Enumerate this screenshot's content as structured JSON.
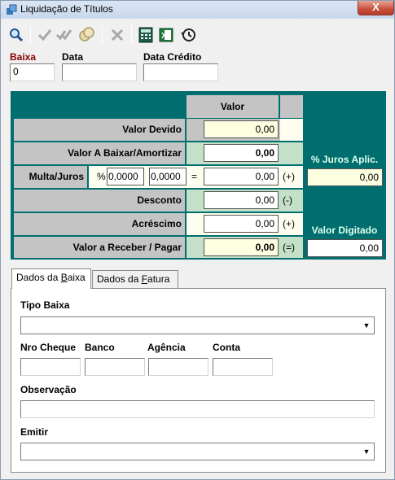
{
  "window": {
    "title": "Liquidação de Títulos",
    "close_label": "X"
  },
  "toolbar": {
    "icons": [
      "search-icon",
      "check-icon",
      "double-check-icon",
      "coins-icon",
      "cancel-icon",
      "calculator-icon",
      "excel-icon",
      "history-icon"
    ]
  },
  "header": {
    "baixa_label": "Baixa",
    "baixa_value": "0",
    "data_label": "Data",
    "data_value": "",
    "data_credito_label": "Data Crédito",
    "data_credito_value": ""
  },
  "panel": {
    "col_header": "Valor",
    "valor_devido": {
      "label": "Valor Devido",
      "value": "0,00"
    },
    "valor_baixar": {
      "label": "Valor A Baixar/Amortizar",
      "value": "0,00"
    },
    "multa_juros": {
      "label": "Multa/Juros",
      "percent_symbol": "%",
      "perc1": "0,0000",
      "perc2": "0,0000",
      "equals": "=",
      "value": "0,00",
      "sign": "(+)"
    },
    "desconto": {
      "label": "Desconto",
      "value": "0,00",
      "sign": "(-)"
    },
    "acrescimo": {
      "label": "Acréscimo",
      "value": "0,00",
      "sign": "(+)"
    },
    "valor_receber": {
      "label": "Valor a Receber / Pagar",
      "value": "0,00",
      "sign": "(=)"
    },
    "juros_aplic": {
      "label": "% Juros Aplic.",
      "value": "0,00"
    },
    "valor_digitado": {
      "label": "Valor Digitado",
      "value": "0,00"
    }
  },
  "tabs": [
    {
      "label_pre": "Dados da ",
      "label_ul": "B",
      "label_post": "aixa"
    },
    {
      "label_pre": "Dados da ",
      "label_ul": "F",
      "label_post": "atura"
    }
  ],
  "baixa_tab": {
    "tipo_baixa_label": "Tipo Baixa",
    "tipo_baixa_value": "",
    "nro_cheque_label": "Nro Cheque",
    "banco_label": "Banco",
    "agencia_label": "Agência",
    "conta_label": "Conta",
    "observacao_label": "Observação",
    "emitir_label": "Emitir",
    "emitir_value": ""
  },
  "colors": {
    "panel_bg": "#006e6e",
    "label_red": "#8b0000",
    "highlight_yellow": "#fdfde0",
    "green_cell": "#c4e0c8"
  }
}
